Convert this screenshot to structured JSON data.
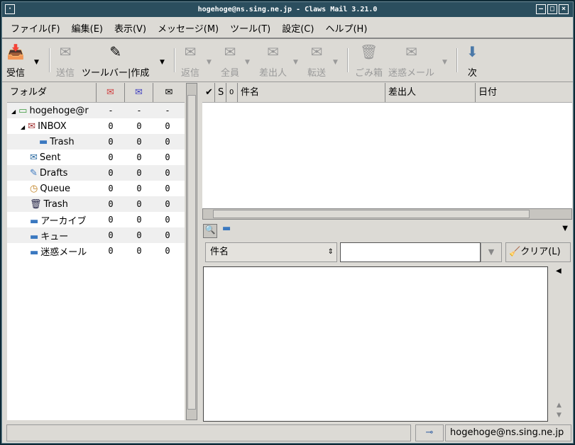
{
  "window": {
    "title": "hogehoge@ns.sing.ne.jp - Claws Mail 3.21.0"
  },
  "menu": [
    "ファイル(F)",
    "編集(E)",
    "表示(V)",
    "メッセージ(M)",
    "ツール(T)",
    "設定(C)",
    "ヘルプ(H)"
  ],
  "toolbar": {
    "receive": "受信",
    "send": "送信",
    "compose": "ツールバー|作成",
    "reply": "返信",
    "reply_all": "全員",
    "reply_sender": "差出人",
    "forward": "転送",
    "trash": "ごみ箱",
    "spam": "迷惑メール",
    "next": "次"
  },
  "folders": {
    "header": "フォルダ",
    "rows": [
      {
        "name": "hogehoge@r",
        "new": "-",
        "unread": "-",
        "total": "-",
        "icon": "account-icon"
      },
      {
        "name": "INBOX",
        "new": "0",
        "unread": "0",
        "total": "0",
        "icon": "inbox-icon"
      },
      {
        "name": "Trash",
        "new": "0",
        "unread": "0",
        "total": "0",
        "icon": "folder-icon"
      },
      {
        "name": "Sent",
        "new": "0",
        "unread": "0",
        "total": "0",
        "icon": "sent-icon"
      },
      {
        "name": "Drafts",
        "new": "0",
        "unread": "0",
        "total": "0",
        "icon": "drafts-icon"
      },
      {
        "name": "Queue",
        "new": "0",
        "unread": "0",
        "total": "0",
        "icon": "queue-icon"
      },
      {
        "name": "Trash",
        "new": "0",
        "unread": "0",
        "total": "0",
        "icon": "trash-icon"
      },
      {
        "name": "アーカイブ",
        "new": "0",
        "unread": "0",
        "total": "0",
        "icon": "folder-icon"
      },
      {
        "name": "キュー",
        "new": "0",
        "unread": "0",
        "total": "0",
        "icon": "folder-icon"
      },
      {
        "name": "迷惑メール",
        "new": "0",
        "unread": "0",
        "total": "0",
        "icon": "folder-icon"
      }
    ]
  },
  "messages": {
    "columns": {
      "check": "✔",
      "status": "S",
      "attach": "0",
      "subject": "件名",
      "from": "差出人",
      "date": "日付"
    }
  },
  "search": {
    "field": "件名",
    "value": "",
    "clear": "クリア(L)"
  },
  "status": {
    "account": "hogehoge@ns.sing.ne.jp"
  }
}
